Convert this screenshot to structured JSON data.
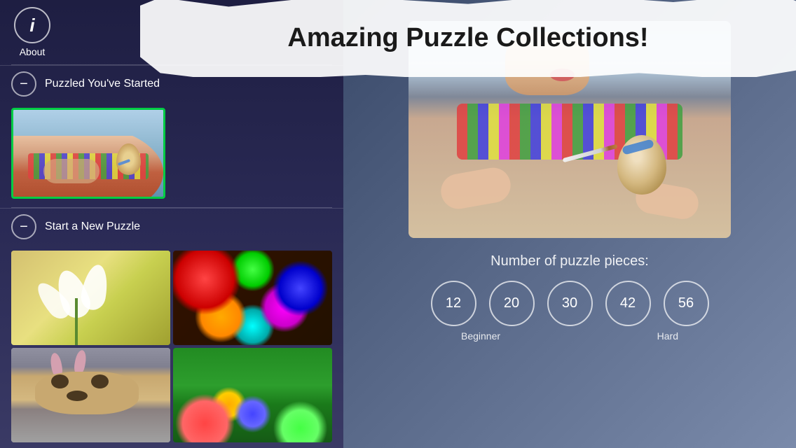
{
  "app": {
    "title": "Amazing Puzzle Collections!"
  },
  "left_panel": {
    "about": {
      "icon": "i",
      "label": "About"
    },
    "sections": [
      {
        "id": "started",
        "label": "Puzzled You've Started"
      },
      {
        "id": "new",
        "label": "Start a New Puzzle"
      }
    ],
    "thumbnails": [
      {
        "id": "thumb-lilies",
        "alt": "White lilies"
      },
      {
        "id": "thumb-candy-eggs",
        "alt": "Colorful candy Easter eggs"
      },
      {
        "id": "thumb-dog",
        "alt": "Dog with Easter bunny ears"
      },
      {
        "id": "thumb-grass-eggs",
        "alt": "Easter eggs on grass"
      }
    ]
  },
  "right_panel": {
    "pieces_label": "Number of puzzle pieces:",
    "piece_counts": [
      {
        "value": "12",
        "difficulty": "Beginner"
      },
      {
        "value": "20",
        "difficulty": ""
      },
      {
        "value": "30",
        "difficulty": ""
      },
      {
        "value": "42",
        "difficulty": ""
      },
      {
        "value": "56",
        "difficulty": "Hard"
      }
    ],
    "difficulty_start": "Beginner",
    "difficulty_end": "Hard"
  }
}
